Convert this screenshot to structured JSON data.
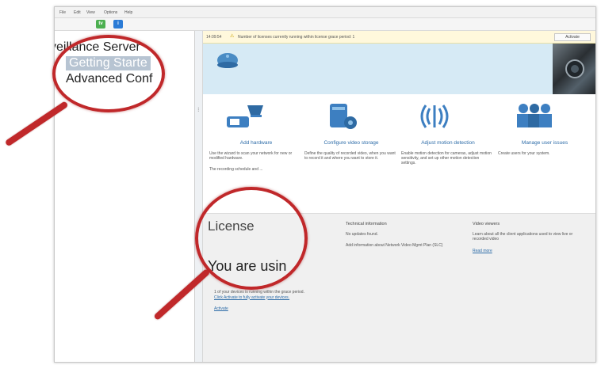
{
  "menubar": {
    "items": [
      "File",
      "Edit",
      "View",
      "Options",
      "Help"
    ]
  },
  "ribbon": {
    "buttons": [
      {
        "icon": "green-tv-icon",
        "label": "tv",
        "color": "#4caf50"
      },
      {
        "icon": "blue-help-icon",
        "label": "i",
        "color": "#2b7bd6"
      }
    ]
  },
  "tree": {
    "items": [
      {
        "label": "veillance Server",
        "selected": false
      },
      {
        "label": "Getting Starte",
        "selected": true
      },
      {
        "label": "Advanced Conf",
        "selected": false
      }
    ]
  },
  "notice": {
    "time": "14:09:54",
    "text": "Number of licenses currently running within license grace period: 1",
    "button": "Activate"
  },
  "steps": [
    {
      "icon": "camera-icon",
      "title": "Add hardware",
      "desc": "Use the wizard to scan your network for new or modified hardware.",
      "extra": "The recording schedule and ..."
    },
    {
      "icon": "storage-icon",
      "title": "Configure video storage",
      "desc": "Define the quality of recorded video, when you want to record it and where you want to store it."
    },
    {
      "icon": "motion-icon",
      "title": "Adjust motion detection",
      "desc": "Enable motion detection for cameras, adjust motion sensitivity, and set up other motion detection settings."
    },
    {
      "icon": "users-icon",
      "title": "Manage user issues",
      "desc": "Create users for your system."
    }
  ],
  "license": {
    "title": "License",
    "status": "You are usin",
    "lines": [
      "1 of your devices is running within the grace period.",
      "Click Activate to fully activate your devices."
    ],
    "link": "Activate",
    "col2_title": "Technical information",
    "col2_lines": [
      "No updates found.",
      "Add information about Network Video Mgmt Plan (SLC)"
    ],
    "col3_title": "Video viewers",
    "col3_lines": [
      "Learn about all the client applications used to view live or recorded video"
    ],
    "col3_link": "Read more"
  },
  "colors": {
    "accent_red": "#c0282a",
    "link_blue": "#2d6ca8",
    "panel_blue": "#d6eaf5"
  }
}
